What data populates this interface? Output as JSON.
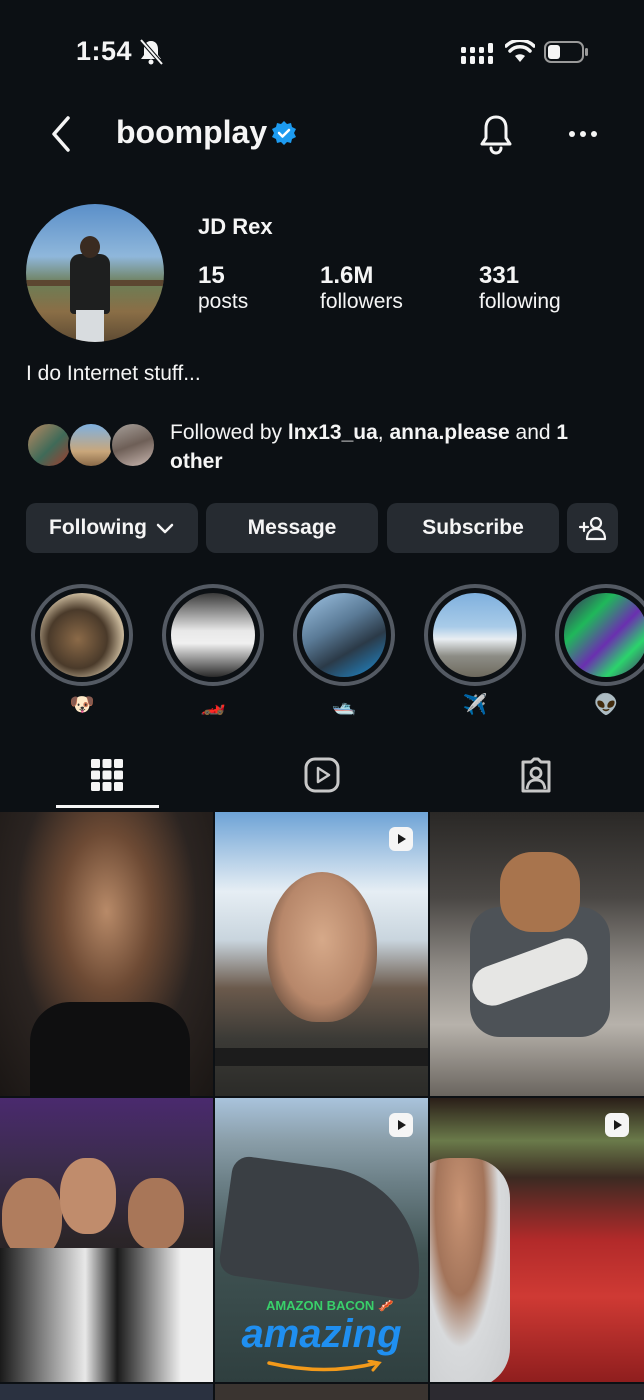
{
  "status_bar": {
    "time": "1:54"
  },
  "nav": {
    "username": "boomplay"
  },
  "profile": {
    "display_name": "JD Rex",
    "stats": [
      {
        "value": "15",
        "label": "posts"
      },
      {
        "value": "1.6M",
        "label": "followers"
      },
      {
        "value": "331",
        "label": "following"
      }
    ],
    "bio": "I do Internet stuff..."
  },
  "followed_by": {
    "prefix": "Followed by ",
    "user1": "lnx13_ua",
    "sep": ", ",
    "user2": "anna.please",
    "middle": " and ",
    "count": "1",
    "suffix_line": "other"
  },
  "buttons": {
    "following": "Following",
    "message": "Message",
    "subscribe": "Subscribe"
  },
  "highlights": [
    {
      "emoji": "🐶"
    },
    {
      "emoji": "🏎️"
    },
    {
      "emoji": "🛥️"
    },
    {
      "emoji": "✈️"
    },
    {
      "emoji": "👽"
    }
  ],
  "grid": {
    "tiles": [
      {
        "type": "photo"
      },
      {
        "type": "reel"
      },
      {
        "type": "photo"
      },
      {
        "type": "photo"
      },
      {
        "type": "reel",
        "caption_top": "AMAZON BACON 🥓",
        "caption_main": "amazing"
      },
      {
        "type": "reel"
      }
    ]
  },
  "colors": {
    "background": "#0c1014",
    "button": "#262b31",
    "verified": "#1d9bf0",
    "highlight_ring": "#545a63"
  }
}
